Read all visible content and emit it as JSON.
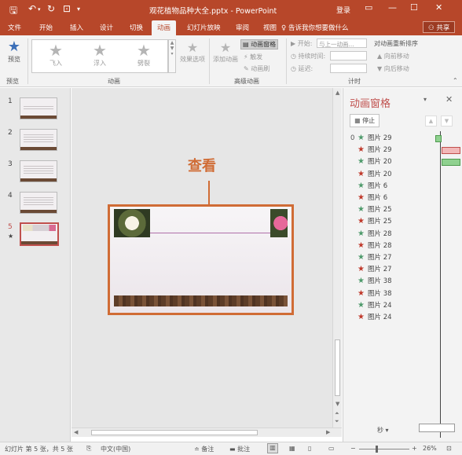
{
  "titlebar": {
    "title": "观花植物品种大全.pptx - PowerPoint",
    "login": "登录"
  },
  "tabs": [
    {
      "label": "文件"
    },
    {
      "label": "开始"
    },
    {
      "label": "插入"
    },
    {
      "label": "设计"
    },
    {
      "label": "切换"
    },
    {
      "label": "动画"
    },
    {
      "label": "幻灯片放映"
    },
    {
      "label": "审阅"
    },
    {
      "label": "视图"
    }
  ],
  "tell_me": "告诉我你想要做什么",
  "share": "共享",
  "ribbon": {
    "preview": "预览",
    "preview_group": "预览",
    "gallery": [
      "飞入",
      "浮入",
      "劈裂"
    ],
    "animation_group": "动画",
    "effect_options": "效果选项",
    "add_animation": "添加动画",
    "animation_pane": "动画窗格",
    "trigger": "触发",
    "animation_painter": "动画刷",
    "advanced_group": "高级动画",
    "start_label": "开始:",
    "start_value": "与上一动画...",
    "duration_label": "持续时间:",
    "delay_label": "延迟:",
    "timing_group": "计时",
    "reorder_title": "对动画重新排序",
    "move_earlier": "向前移动",
    "move_later": "向后移动"
  },
  "slides": [
    {
      "num": "1"
    },
    {
      "num": "2"
    },
    {
      "num": "3"
    },
    {
      "num": "4"
    },
    {
      "num": "5",
      "star": "★"
    }
  ],
  "canvas": {
    "callout": "查看"
  },
  "anim_pane": {
    "title": "动画窗格",
    "stop": "停止",
    "first_num": "0",
    "rows": [
      {
        "color": "green",
        "label": "图片 29"
      },
      {
        "color": "red",
        "label": "图片 29"
      },
      {
        "color": "green",
        "label": "图片 20"
      },
      {
        "color": "red",
        "label": "图片 20"
      },
      {
        "color": "green",
        "label": "图片 6"
      },
      {
        "color": "red",
        "label": "图片 6"
      },
      {
        "color": "green",
        "label": "图片 25"
      },
      {
        "color": "red",
        "label": "图片 25"
      },
      {
        "color": "green",
        "label": "图片 28"
      },
      {
        "color": "red",
        "label": "图片 28"
      },
      {
        "color": "green",
        "label": "图片 27"
      },
      {
        "color": "red",
        "label": "图片 27"
      },
      {
        "color": "green",
        "label": "图片 38"
      },
      {
        "color": "red",
        "label": "图片 38"
      },
      {
        "color": "green",
        "label": "图片 24"
      },
      {
        "color": "red",
        "label": "图片 24"
      }
    ],
    "seconds": "秒"
  },
  "statusbar": {
    "slide_info": "幻灯片 第 5 张，共 5 张",
    "language": "中文(中国)",
    "notes": "备注",
    "comments": "批注",
    "zoom": "26%"
  },
  "colors": {
    "accent": "#b7472a",
    "callout": "#d06c35",
    "pane_title": "#c0504d",
    "entrance_star": "#4e9a6b",
    "exit_star": "#c0392b"
  }
}
